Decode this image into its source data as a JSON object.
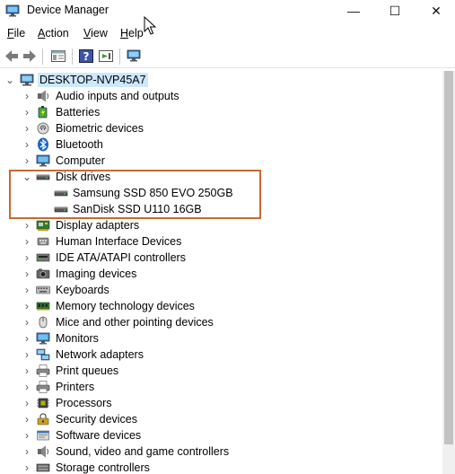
{
  "window": {
    "title": "Device Manager",
    "controls": {
      "minimize": "—",
      "maximize": "☐",
      "close": "✕"
    }
  },
  "menubar": {
    "items": [
      {
        "name": "menu-file",
        "label_u": "F",
        "label_rest": "ile"
      },
      {
        "name": "menu-action",
        "label_u": "A",
        "label_rest": "ction"
      },
      {
        "name": "menu-view",
        "label_u": "V",
        "label_rest": "iew"
      },
      {
        "name": "menu-help",
        "label_u": "H",
        "label_rest": "elp"
      }
    ]
  },
  "toolbar": {
    "buttons": [
      "back-icon",
      "forward-icon",
      "properties-icon",
      "help-icon",
      "update-driver-icon",
      "scan-hardware-icon"
    ]
  },
  "tree": {
    "root": {
      "label": "DESKTOP-NVP45A7",
      "expanded": true,
      "icon": "computer-icon"
    },
    "categories": [
      {
        "label": "Audio inputs and outputs",
        "icon": "speaker-icon",
        "expanded": false
      },
      {
        "label": "Batteries",
        "icon": "battery-icon",
        "expanded": false
      },
      {
        "label": "Biometric devices",
        "icon": "fingerprint-icon",
        "expanded": false
      },
      {
        "label": "Bluetooth",
        "icon": "bluetooth-icon",
        "expanded": false
      },
      {
        "label": "Computer",
        "icon": "monitor-icon",
        "expanded": false
      },
      {
        "label": "Disk drives",
        "icon": "disk-drive-icon",
        "expanded": true,
        "children": [
          {
            "label": "Samsung SSD 850 EVO 250GB",
            "icon": "disk-drive-icon"
          },
          {
            "label": "SanDisk SSD U110 16GB",
            "icon": "disk-drive-icon"
          }
        ]
      },
      {
        "label": "Display adapters",
        "icon": "display-adapter-icon",
        "expanded": false
      },
      {
        "label": "Human Interface Devices",
        "icon": "hid-icon",
        "expanded": false
      },
      {
        "label": "IDE ATA/ATAPI controllers",
        "icon": "ide-controller-icon",
        "expanded": false
      },
      {
        "label": "Imaging devices",
        "icon": "camera-icon",
        "expanded": false
      },
      {
        "label": "Keyboards",
        "icon": "keyboard-icon",
        "expanded": false
      },
      {
        "label": "Memory technology devices",
        "icon": "memory-icon",
        "expanded": false
      },
      {
        "label": "Mice and other pointing devices",
        "icon": "mouse-icon",
        "expanded": false
      },
      {
        "label": "Monitors",
        "icon": "monitor-icon",
        "expanded": false
      },
      {
        "label": "Network adapters",
        "icon": "network-icon",
        "expanded": false
      },
      {
        "label": "Print queues",
        "icon": "printer-icon",
        "expanded": false
      },
      {
        "label": "Printers",
        "icon": "printer-icon",
        "expanded": false
      },
      {
        "label": "Processors",
        "icon": "processor-icon",
        "expanded": false
      },
      {
        "label": "Security devices",
        "icon": "security-icon",
        "expanded": false
      },
      {
        "label": "Software devices",
        "icon": "software-device-icon",
        "expanded": false
      },
      {
        "label": "Sound, video and game controllers",
        "icon": "speaker-icon",
        "expanded": false
      },
      {
        "label": "Storage controllers",
        "icon": "storage-controller-icon",
        "expanded": false
      }
    ]
  },
  "colors": {
    "selection": "#cce8ff",
    "annotation_box": "#c96a2f",
    "scroll_thumb": "#c2c2c2"
  }
}
